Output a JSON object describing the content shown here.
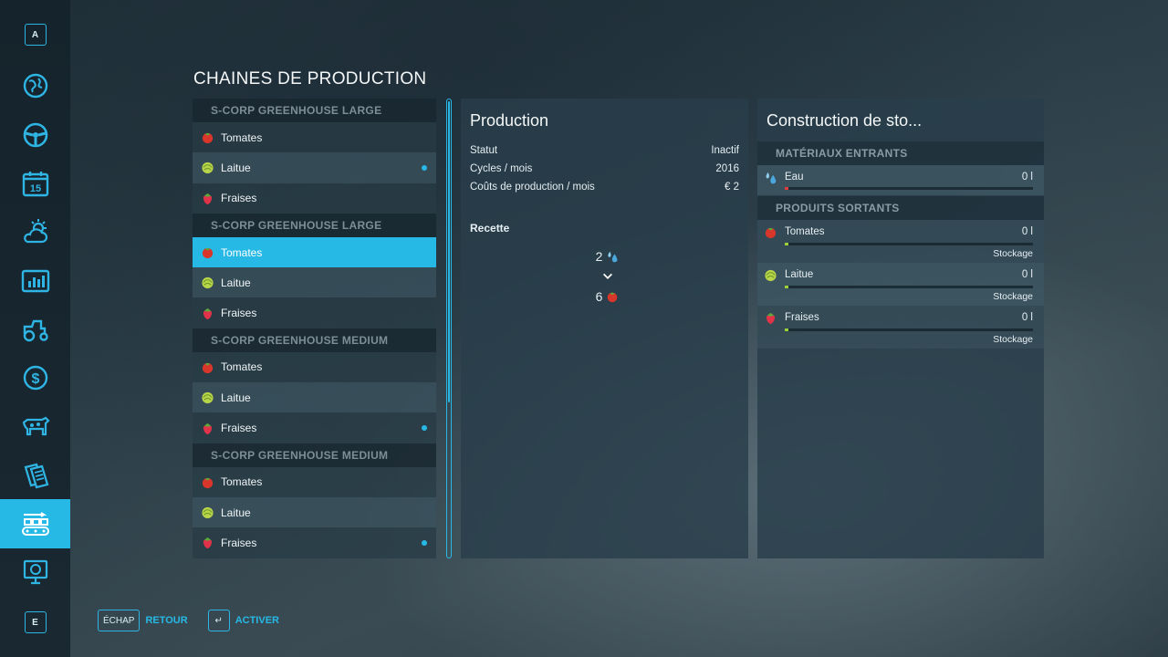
{
  "page_title": "CHAINES DE PRODUCTION",
  "sidebar": {
    "top_key": "A",
    "bottom_key": "E",
    "items": [
      {
        "icon": "map-globe-icon"
      },
      {
        "icon": "steering-wheel-icon"
      },
      {
        "icon": "calendar-icon",
        "label": "15"
      },
      {
        "icon": "weather-icon"
      },
      {
        "icon": "statistics-icon"
      },
      {
        "icon": "tractor-icon"
      },
      {
        "icon": "finances-icon"
      },
      {
        "icon": "animals-icon"
      },
      {
        "icon": "contracts-icon"
      },
      {
        "icon": "production-icon",
        "active": true
      },
      {
        "icon": "help-icon"
      }
    ]
  },
  "chains": [
    {
      "header": "S-CORP GREENHOUSE LARGE",
      "items": [
        {
          "label": "Tomates",
          "icon": "tomato-icon"
        },
        {
          "label": "Laitue",
          "icon": "lettuce-icon",
          "dot": true
        },
        {
          "label": "Fraises",
          "icon": "strawberry-icon"
        }
      ]
    },
    {
      "header": "S-CORP GREENHOUSE LARGE",
      "items": [
        {
          "label": "Tomates",
          "icon": "tomato-icon",
          "selected": true
        },
        {
          "label": "Laitue",
          "icon": "lettuce-icon"
        },
        {
          "label": "Fraises",
          "icon": "strawberry-icon"
        }
      ]
    },
    {
      "header": "S-CORP GREENHOUSE MEDIUM",
      "items": [
        {
          "label": "Tomates",
          "icon": "tomato-icon"
        },
        {
          "label": "Laitue",
          "icon": "lettuce-icon"
        },
        {
          "label": "Fraises",
          "icon": "strawberry-icon",
          "dot": true
        }
      ]
    },
    {
      "header": "S-CORP GREENHOUSE MEDIUM",
      "items": [
        {
          "label": "Tomates",
          "icon": "tomato-icon"
        },
        {
          "label": "Laitue",
          "icon": "lettuce-icon"
        },
        {
          "label": "Fraises",
          "icon": "strawberry-icon",
          "dot": true
        }
      ]
    }
  ],
  "production": {
    "title": "Production",
    "stats": [
      {
        "label": "Statut",
        "value": "Inactif"
      },
      {
        "label": "Cycles / mois",
        "value": "2016"
      },
      {
        "label": "Coûts de production / mois",
        "value": "€ 2"
      }
    ],
    "recipe_label": "Recette",
    "recipe": {
      "input_amount": "2",
      "input_icon": "water-icon",
      "output_amount": "6",
      "output_icon": "tomato-icon"
    }
  },
  "storage": {
    "title": "Construction de sto...",
    "inputs_header": "MATÉRIAUX ENTRANTS",
    "inputs": [
      {
        "name": "Eau",
        "icon": "water-icon",
        "amount": "0 l",
        "bar_color": "#e03a3a",
        "fill": 0
      }
    ],
    "outputs_header": "PRODUITS SORTANTS",
    "outputs": [
      {
        "name": "Tomates",
        "icon": "tomato-icon",
        "amount": "0 l",
        "mode": "Stockage",
        "bar_color": "#9ad03a",
        "fill": 0
      },
      {
        "name": "Laitue",
        "icon": "lettuce-icon",
        "amount": "0 l",
        "mode": "Stockage",
        "bar_color": "#9ad03a",
        "fill": 0
      },
      {
        "name": "Fraises",
        "icon": "strawberry-icon",
        "amount": "0 l",
        "mode": "Stockage",
        "bar_color": "#9ad03a",
        "fill": 0
      }
    ]
  },
  "footer": {
    "back_key": "ÉCHAP",
    "back_label": "RETOUR",
    "activate_key": "↵",
    "activate_label": "ACTIVER"
  },
  "colors": {
    "accent": "#27b9e6",
    "panel": "#283e4a",
    "sidebar": "#15232c"
  }
}
